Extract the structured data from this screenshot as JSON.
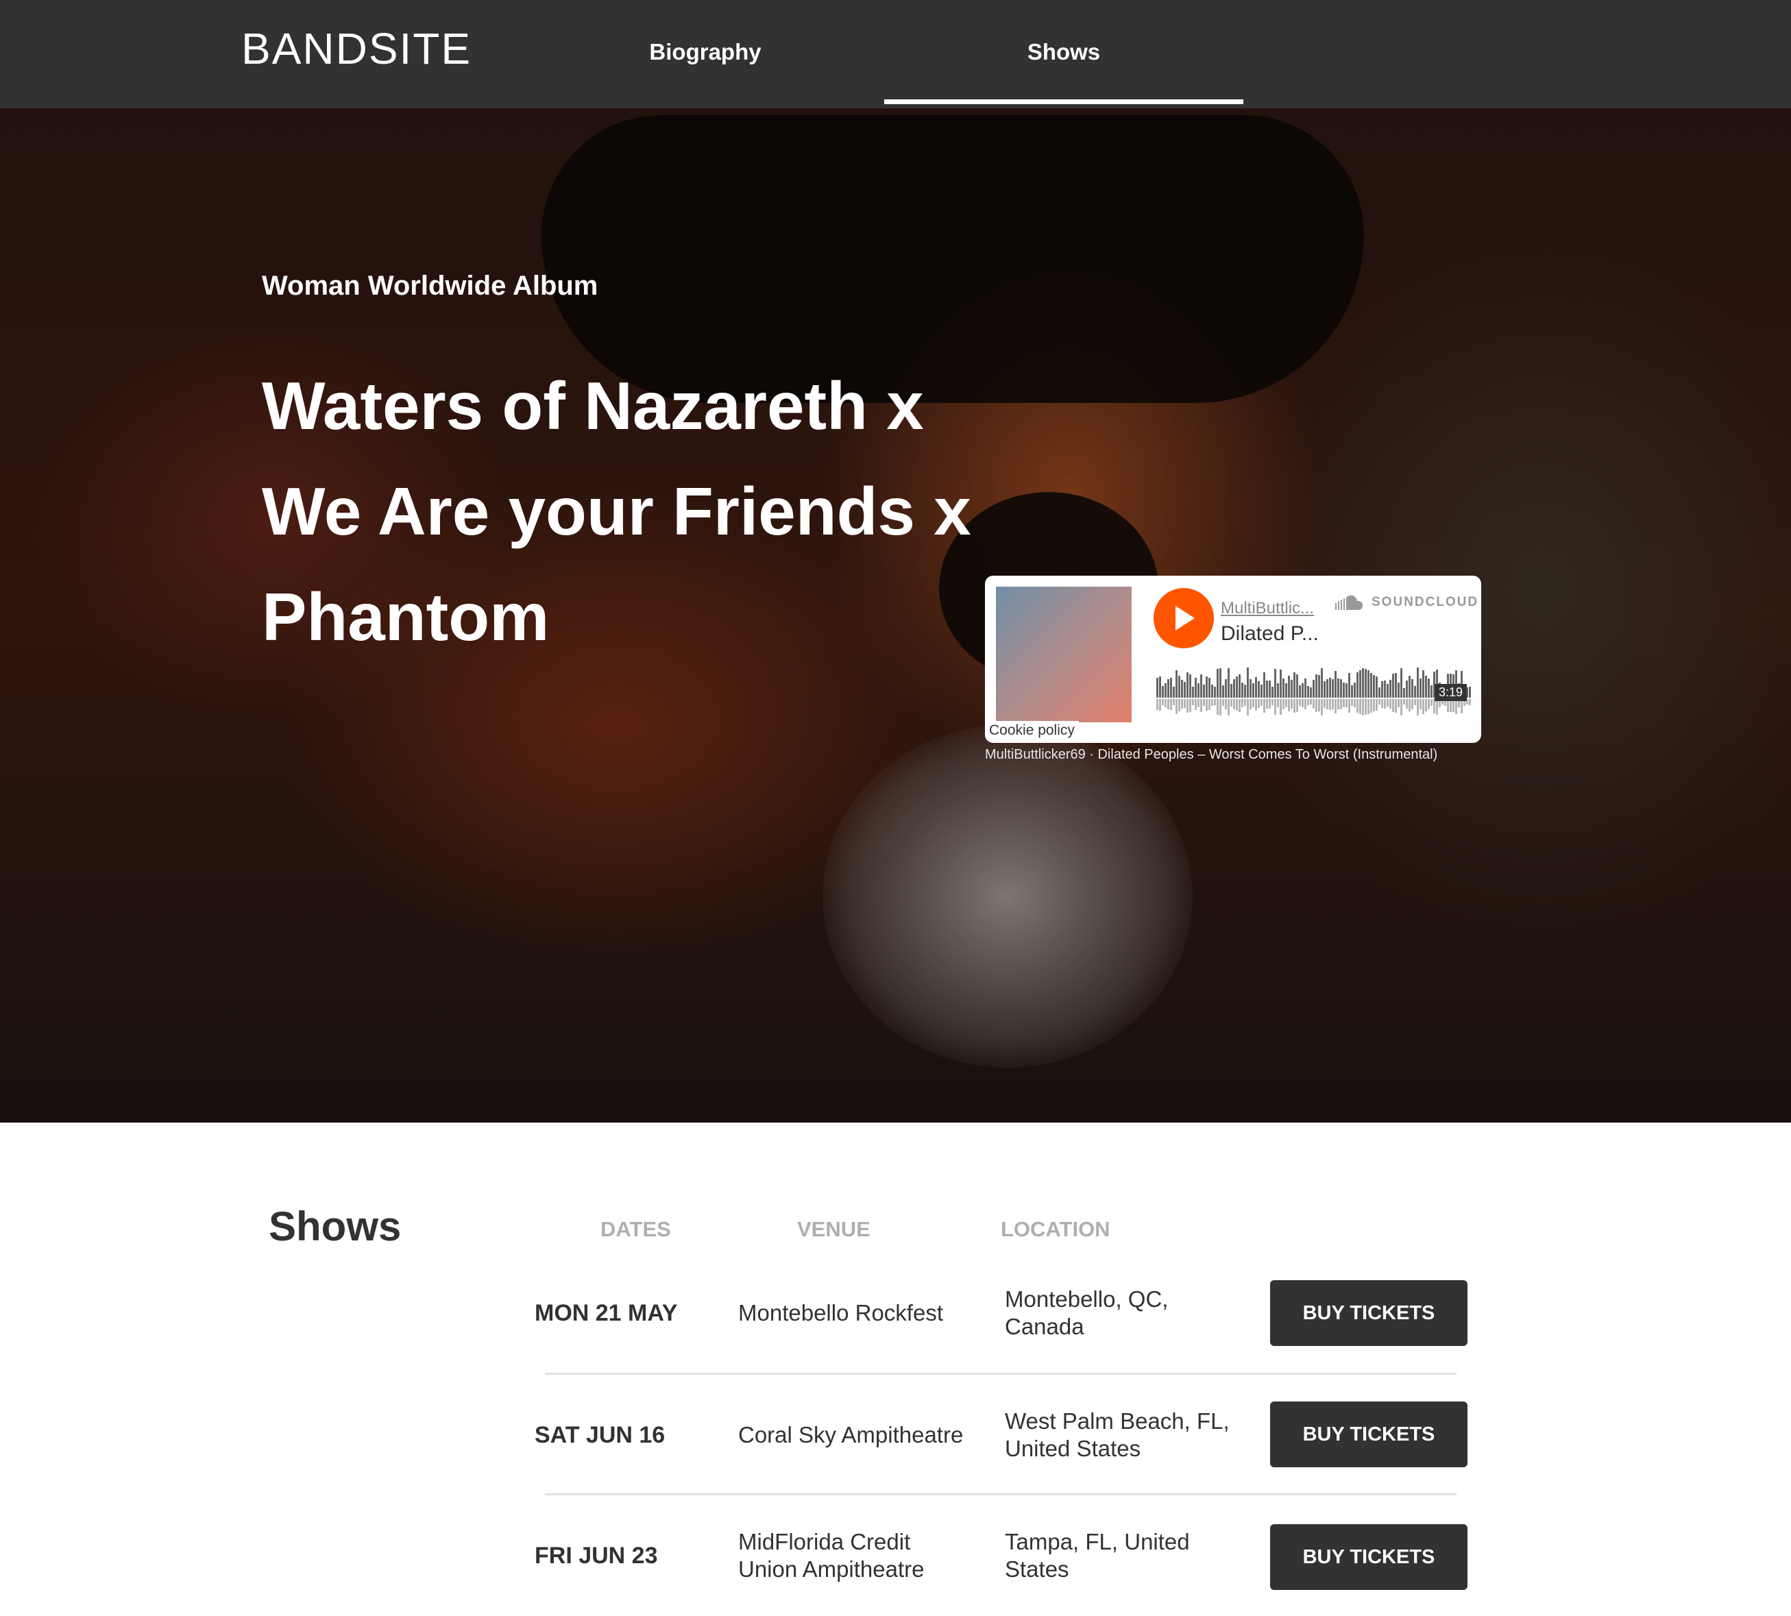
{
  "nav": {
    "logo": "BANDSITE",
    "links": [
      "Biography",
      "Shows"
    ],
    "active": "Shows"
  },
  "hero": {
    "subtitle": "Woman Worldwide Album",
    "title": "Waters of Nazareth x We Are your Friends x Phantom"
  },
  "soundcloud": {
    "user": "MultiButtlic...",
    "track": "Dilated P...",
    "brand": "SOUNDCLOUD",
    "duration": "3:19",
    "cookie": "Cookie policy",
    "caption": "MultiButtlicker69 · Dilated Peoples – Worst Comes To Worst (Instrumental)"
  },
  "shows": {
    "title": "Shows",
    "columns": [
      "DATES",
      "VENUE",
      "LOCATION"
    ],
    "button_label": "BUY TICKETS",
    "rows": [
      {
        "date": "MON 21 MAY",
        "venue": "Montebello Rockfest",
        "location": "Montebello, QC, Canada"
      },
      {
        "date": "SAT JUN 16",
        "venue": "Coral Sky Ampitheatre",
        "location": "West Palm Beach, FL, United States"
      },
      {
        "date": "FRI JUN 23",
        "venue": "MidFlorida Credit Union Ampitheatre",
        "location": "Tampa, FL, United States"
      }
    ]
  },
  "colors": {
    "nav_bg": "#323232",
    "text_dark": "#323232",
    "header_gray": "#afafaf",
    "soundcloud_orange": "#ff5500"
  }
}
